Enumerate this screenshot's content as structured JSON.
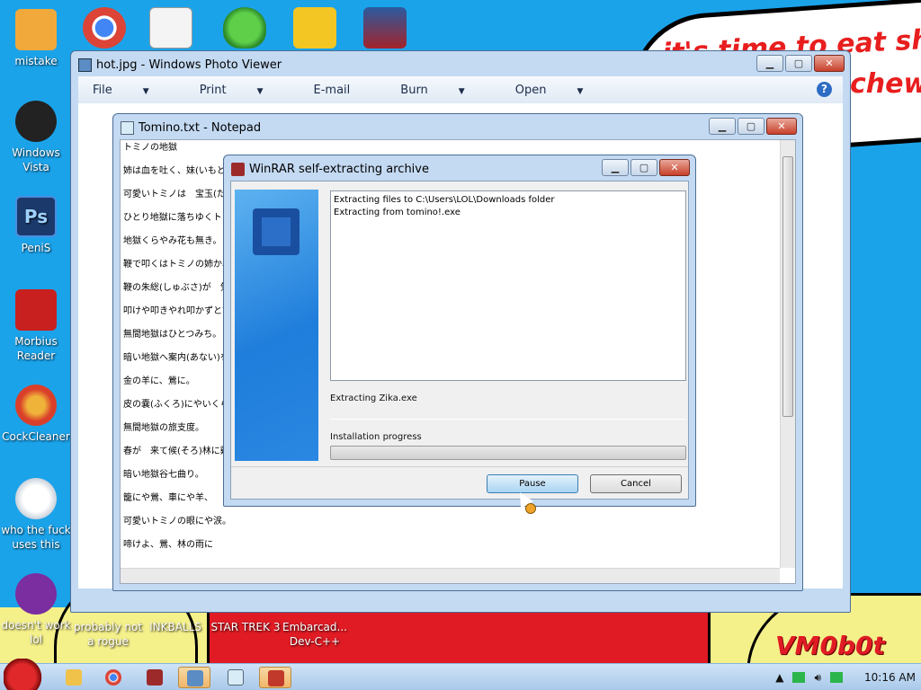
{
  "desktop": {
    "icons": [
      {
        "label": "mistake",
        "color": "#f2a93b"
      },
      {
        "label": "Windows Vista",
        "color": "#222222"
      },
      {
        "label": "PeniS",
        "color": "#1b3a6b"
      },
      {
        "label": "Morbius Reader",
        "color": "#c8201e"
      },
      {
        "label": "CockCleaner",
        "color": "#d93f2a"
      },
      {
        "label": "who the fuck uses this",
        "color": "#e9edf2"
      },
      {
        "label": "doesn't work lol",
        "color": "#7a2ea0"
      }
    ],
    "bottom_icons": [
      {
        "label": "probably not a rogue"
      },
      {
        "label": "INKBALLS"
      },
      {
        "label": "STAR TREK 3"
      },
      {
        "label": "Embarcad... Dev-C++"
      }
    ],
    "top_icons": [
      "chrome-icon",
      "solitaire-icon",
      "security-shield-icon",
      "angry-birds-icon",
      "winrar-like-icon"
    ],
    "cloud_line1": "it's time to eat shit",
    "cloud_line2": "chew",
    "corner_text": "VM0b0t"
  },
  "photo_viewer": {
    "title": "hot.jpg - Windows Photo Viewer",
    "menu": [
      "File",
      "Print",
      "E-mail",
      "Burn",
      "Open"
    ]
  },
  "notepad": {
    "title": "Tomino.txt - Notepad",
    "lines": [
      "トミノの地獄",
      "姉は血を吐く、妹(いもと)は",
      "可愛いトミノは　宝玉(たま)",
      "ひとり地獄に落ちゆくトミノ、",
      "地獄くらやみ花も無き。",
      "鞭で叩くはトミノの姉か、",
      "鞭の朱総(しゅぶさ)が　気に",
      "叩けや叩きやれ叩かずとても、",
      "無間地獄はひとつみち。",
      "暗い地獄へ案内(あない)をな",
      "金の羊に、鶯に。",
      "皮の嚢(ふくろ)にやいくらほど",
      "無間地獄の旅支度。",
      "春が　来て候(そろ)林に谿(",
      "暗い地獄谷七曲り。",
      "籠にや鶯、車にや羊、",
      "可愛いトミノの眼にや涙。",
      "啼けよ、鶯、林の雨に"
    ]
  },
  "winrar": {
    "title": "WinRAR self-extracting archive",
    "log_lines": [
      "Extracting files to C:\\Users\\LOL\\Downloads folder",
      "Extracting from tomino!.exe"
    ],
    "current_file": "Extracting Zika.exe",
    "progress_label": "Installation progress",
    "progress": 0,
    "pause_label": "Pause",
    "cancel_label": "Cancel"
  },
  "taskbar": {
    "clock": "10:16 AM"
  }
}
